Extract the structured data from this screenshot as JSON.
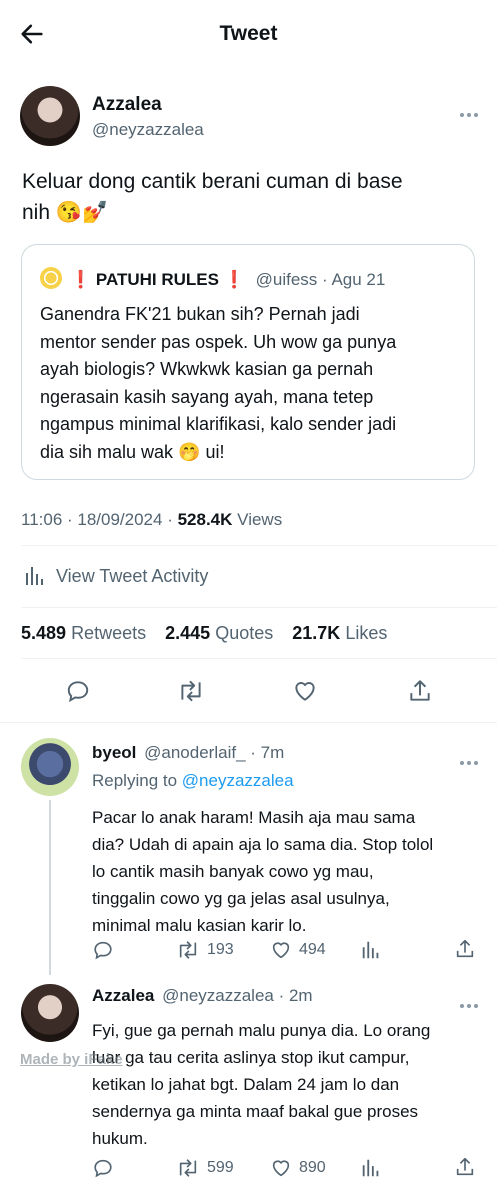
{
  "header": {
    "title": "Tweet"
  },
  "tweet": {
    "name": "Azzalea",
    "handle": "@neyzazzalea",
    "text_line1": "Keluar dong cantik berani cuman di base",
    "text_line2": "nih 😘💅",
    "quote": {
      "name": "❗ PATUHI RULES ❗",
      "handle": "@uifess",
      "date": "· Agu 21",
      "lines": [
        "Ganendra FK'21 bukan sih? Pernah jadi",
        "mentor sender pas ospek. Uh wow ga punya",
        "ayah biologis? Wkwkwk kasian ga pernah",
        "ngerasain kasih sayang ayah, mana tetep",
        "ngampus minimal klarifikasi, kalo sender jadi",
        "dia sih malu wak 🤭 ui!"
      ]
    },
    "timestamp": "11:06 · 18/09/2024 ·",
    "views_count": "528.4K",
    "views_label": "Views",
    "activity_label": "View Tweet Activity",
    "retweets_count": "5.489",
    "retweets_label": "Retweets",
    "quotes_count": "2.445",
    "quotes_label": "Quotes",
    "likes_count": "21.7K",
    "likes_label": "Likes"
  },
  "replies": [
    {
      "name": "byeol",
      "handle_time": "@anoderlaif_ · 7m",
      "replying_prefix": "Replying to",
      "replying_handle": "@neyzazzalea",
      "lines": [
        "Pacar lo anak haram! Masih aja mau sama",
        "dia? Udah di apain aja lo sama dia. Stop tolol",
        "lo cantik masih banyak cowo yg mau,",
        "tinggalin cowo yg ga jelas asal usulnya,",
        "minimal malu kasian karir lo."
      ],
      "retweets": "193",
      "likes": "494"
    },
    {
      "name": "Azzalea",
      "handle_time": "@neyzazzalea · 2m",
      "lines": [
        "Fyi, gue ga pernah malu punya dia. Lo orang",
        "luar ga tau cerita aslinya stop ikut campur,",
        "ketikan lo jahat bgt. Dalam 24 jam lo dan",
        "sendernya ga minta maaf bakal gue proses",
        "hukum."
      ],
      "retweets": "599",
      "likes": "890"
    }
  ],
  "watermark": "Made by iFake",
  "colors": {
    "link": "#1d9bf0",
    "muted": "#536471",
    "divider": "#eff3f4",
    "text": "#0f1419"
  }
}
